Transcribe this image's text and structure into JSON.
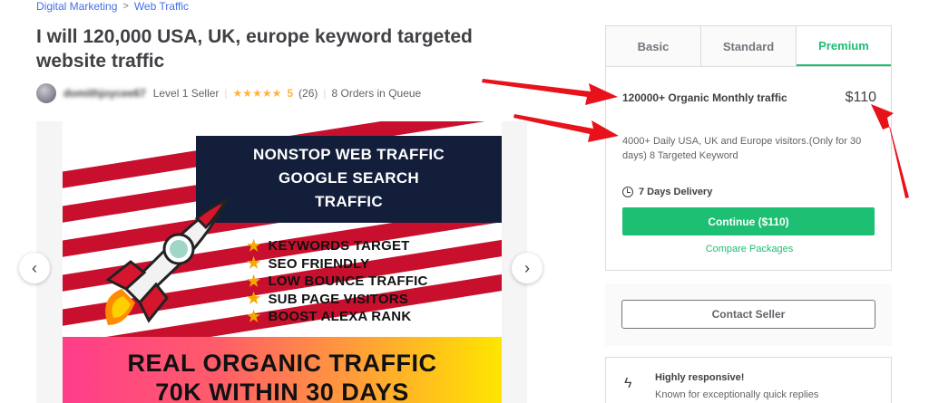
{
  "breadcrumb": {
    "items": [
      "Digital Marketing",
      "Web Traffic"
    ],
    "separator": ">"
  },
  "gig": {
    "title": "I will 120,000 USA, UK, europe keyword targeted website traffic"
  },
  "seller": {
    "username": "domithjoycee67",
    "level": "Level 1 Seller",
    "stars": "★★★★★",
    "rating": "5",
    "reviews": "(26)",
    "orders_in_queue": "8 Orders in Queue"
  },
  "gallery": {
    "banner_heading": [
      "NONSTOP WEB TRAFFIC",
      "GOOGLE SEARCH",
      "TRAFFIC"
    ],
    "features": [
      "KEYWORDS TARGET",
      "SEO FRIENDLY",
      "LOW BOUNCE TRAFFIC",
      "SUB PAGE VISITORS",
      "BOOST ALEXA RANK"
    ],
    "bottom_line1": "REAL ORGANIC TRAFFIC",
    "bottom_line2": "70K WITHIN 30 DAYS",
    "prev_icon": "‹",
    "next_icon": "›"
  },
  "packages": {
    "tabs": [
      {
        "label": "Basic",
        "active": false
      },
      {
        "label": "Standard",
        "active": false
      },
      {
        "label": "Premium",
        "active": true
      }
    ],
    "title": "120000+ Organic Monthly traffic",
    "price": "$110",
    "description": "4000+ Daily USA, UK and Europe visitors.(Only for 30 days) 8 Targeted Keyword",
    "delivery": "7 Days Delivery",
    "continue_label": "Continue ($110)",
    "compare_label": "Compare Packages"
  },
  "contact": {
    "label": "Contact Seller"
  },
  "responsive": {
    "title": "Highly responsive!",
    "text": "Known for exceptionally quick replies"
  },
  "colors": {
    "accent": "#1dbf73",
    "link": "#446ee7",
    "star": "#ffb33e",
    "annotation": "#e8121b"
  }
}
